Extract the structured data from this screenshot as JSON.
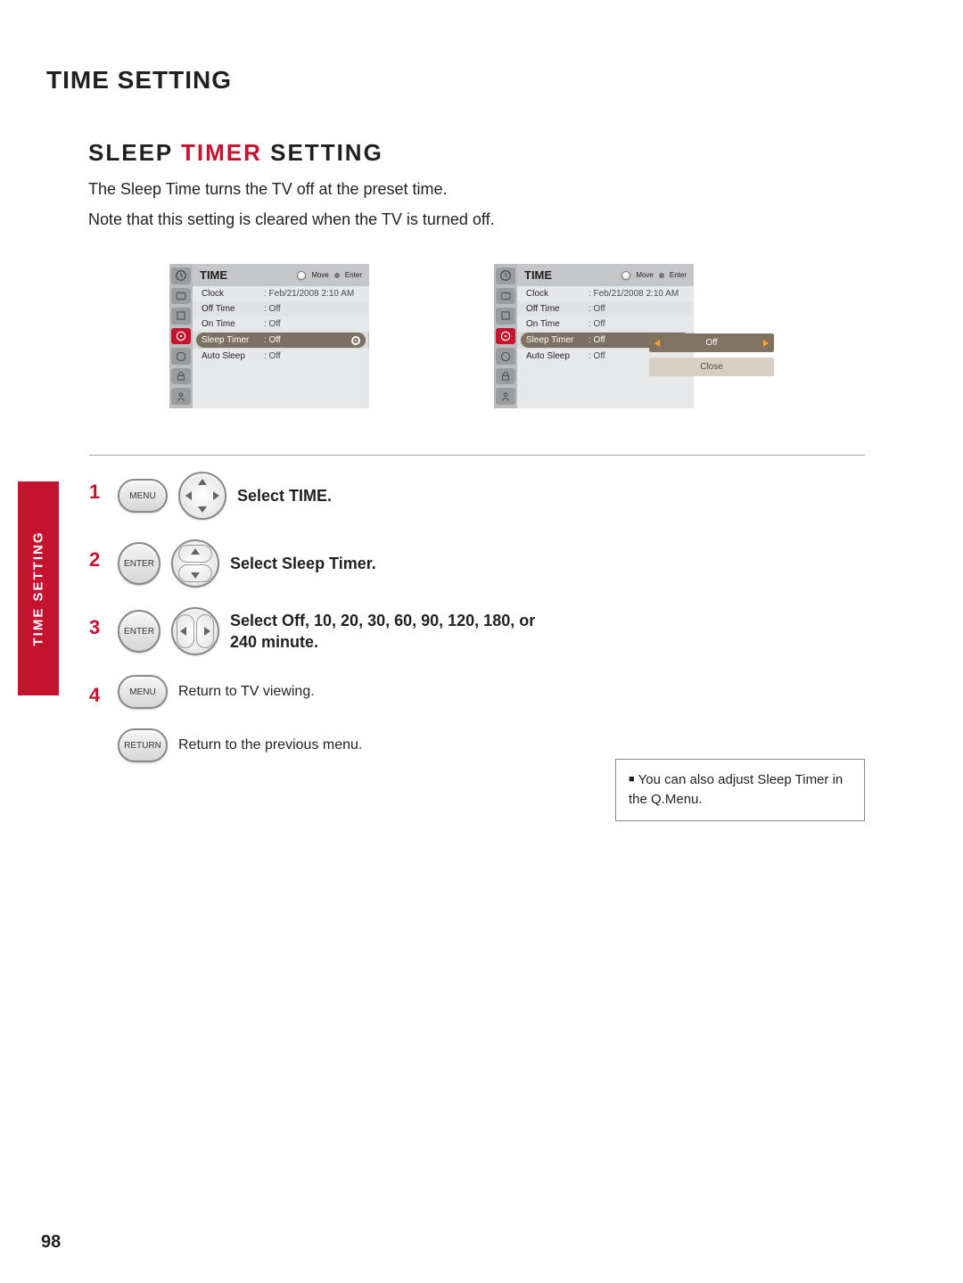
{
  "header": {
    "title_pre": "TIME",
    "title_amp_space": " ",
    "title_post": "SETTING"
  },
  "section": {
    "title_pre": "SLEEP",
    "title_mid": " TIMER ",
    "title_post": "SETTING"
  },
  "intro": {
    "line1": "The Sleep Time turns the TV off at the preset time.",
    "line2": "Note that this setting is cleared when the TV is turned off."
  },
  "side_tab": "TIME SETTING",
  "osd": {
    "title": "TIME",
    "hint_move": "Move",
    "hint_enter": "Enter",
    "rows": [
      {
        "label": "Clock",
        "value": ": Feb/21/2008  2:10 AM"
      },
      {
        "label": "Off Time",
        "value": ": Off"
      },
      {
        "label": "On Time",
        "value": ": Off"
      },
      {
        "label": "Sleep Timer",
        "value": ": Off"
      },
      {
        "label": "Auto Sleep",
        "value": ": Off"
      }
    ],
    "popup": {
      "value": "Off",
      "close": "Close"
    }
  },
  "steps": {
    "s1": {
      "num": "1",
      "btn": "MENU",
      "text": "Select TIME."
    },
    "s2": {
      "num": "2",
      "btn": "ENTER",
      "text": "Select Sleep Timer."
    },
    "s3": {
      "num": "3",
      "btn": "ENTER",
      "text": "Select Off, 10, 20, 30, 60, 90, 120, 180, or 240 minute."
    },
    "s4": {
      "num": "4",
      "btn": "MENU",
      "text": "Return to TV viewing."
    },
    "s5": {
      "btn": "RETURN",
      "text": "Return to the previous menu."
    }
  },
  "note": {
    "text": "You can also adjust Sleep Timer in the Q.Menu."
  },
  "pagenum": "98"
}
